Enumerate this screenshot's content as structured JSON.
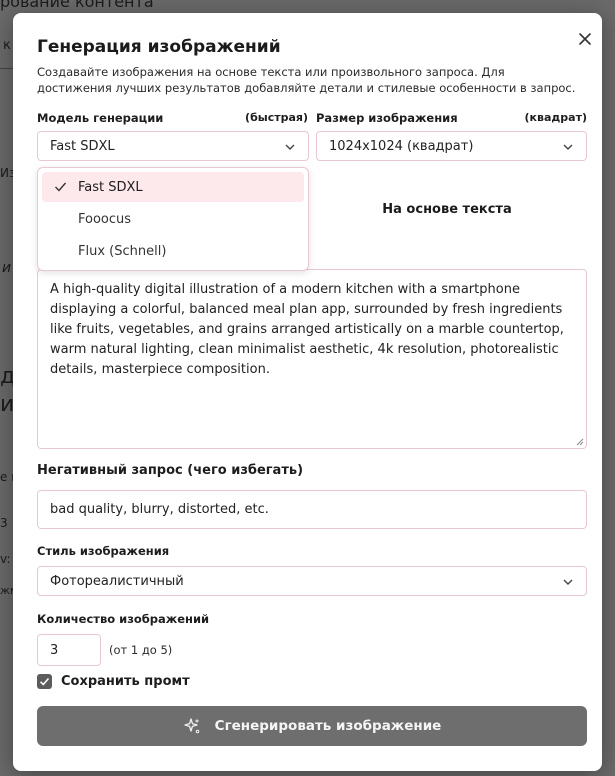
{
  "backdrop": {
    "snippets": [
      "рование контента",
      "к",
      "Из",
      "и",
      "ду",
      "им",
      "е и",
      "3",
      "v:",
      "жм"
    ]
  },
  "dialog": {
    "title": "Генерация изображений",
    "description": "Создавайте изображения на основе текста или произвольного запроса. Для достижения лучших результатов добавляйте детали и стилевые особенности в запрос.",
    "close_icon": "close-icon"
  },
  "model": {
    "label": "Модель генерации",
    "hint": "(быстрая)",
    "selected": "Fast SDXL",
    "options": [
      {
        "label": "Fast SDXL",
        "selected": true
      },
      {
        "label": "Fooocus",
        "selected": false
      },
      {
        "label": "Flux (Schnell)",
        "selected": false
      }
    ]
  },
  "size": {
    "label": "Размер изображения",
    "hint": "(квадрат)",
    "selected": "1024x1024 (квадрат)"
  },
  "mode_tab": {
    "label": "На основе текста"
  },
  "prompt": {
    "value": "A high-quality digital illustration of a modern kitchen with a smartphone displaying a colorful, balanced meal plan app, surrounded by fresh ingredients like fruits, vegetables, and grains arranged artistically on a marble countertop, warm natural lighting, clean minimalist aesthetic, 4k resolution, photorealistic details, masterpiece composition."
  },
  "negative": {
    "label": "Негативный запрос (чего избегать)",
    "value": "bad quality, blurry, distorted, etc."
  },
  "style": {
    "label": "Стиль изображения",
    "selected": "Фотореалистичный"
  },
  "count": {
    "label": "Количество изображений",
    "value": "3",
    "hint": "(от 1 до 5)"
  },
  "save_prompt": {
    "label": "Сохранить промт",
    "checked": true
  },
  "generate": {
    "label": "Сгенерировать изображение",
    "icon": "sparkles-icon"
  },
  "colors": {
    "accent_border": "#e8c9cf",
    "option_highlight": "#fde8ec",
    "button_bg": "#6e6e6e"
  }
}
